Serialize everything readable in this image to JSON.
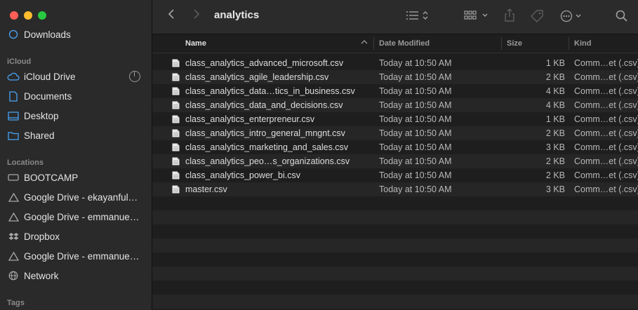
{
  "sidebar": {
    "partial_item": "Downloads",
    "sections": {
      "icloud": "iCloud",
      "locations": "Locations",
      "tags": "Tags"
    },
    "icloud_items": [
      "iCloud Drive",
      "Documents",
      "Desktop",
      "Shared"
    ],
    "location_items": [
      "BOOTCAMP",
      "Google Drive - ekayanful…",
      "Google Drive - emmanue…",
      "Dropbox",
      "Google Drive - emmanue…",
      "Network"
    ]
  },
  "toolbar": {
    "title": "analytics"
  },
  "columns": {
    "name": "Name",
    "date": "Date Modified",
    "size": "Size",
    "kind": "Kind"
  },
  "files": [
    {
      "name": "class_analytics_advanced_microsoft.csv",
      "date": "Today at 10:50 AM",
      "size": "1 KB",
      "kind": "Comm…et (.csv)"
    },
    {
      "name": "class_analytics_agile_leadership.csv",
      "date": "Today at 10:50 AM",
      "size": "2 KB",
      "kind": "Comm…et (.csv)"
    },
    {
      "name": "class_analytics_data…tics_in_business.csv",
      "date": "Today at 10:50 AM",
      "size": "4 KB",
      "kind": "Comm…et (.csv)"
    },
    {
      "name": "class_analytics_data_and_decisions.csv",
      "date": "Today at 10:50 AM",
      "size": "4 KB",
      "kind": "Comm…et (.csv)"
    },
    {
      "name": "class_analytics_enterpreneur.csv",
      "date": "Today at 10:50 AM",
      "size": "1 KB",
      "kind": "Comm…et (.csv)"
    },
    {
      "name": "class_analytics_intro_general_mngnt.csv",
      "date": "Today at 10:50 AM",
      "size": "2 KB",
      "kind": "Comm…et (.csv)"
    },
    {
      "name": "class_analytics_marketing_and_sales.csv",
      "date": "Today at 10:50 AM",
      "size": "3 KB",
      "kind": "Comm…et (.csv)"
    },
    {
      "name": "class_analytics_peo…s_organizations.csv",
      "date": "Today at 10:50 AM",
      "size": "2 KB",
      "kind": "Comm…et (.csv)"
    },
    {
      "name": "class_analytics_power_bi.csv",
      "date": "Today at 10:50 AM",
      "size": "2 KB",
      "kind": "Comm…et (.csv)"
    },
    {
      "name": "master.csv",
      "date": "Today at 10:50 AM",
      "size": "3 KB",
      "kind": "Comm…et (.csv)"
    }
  ]
}
